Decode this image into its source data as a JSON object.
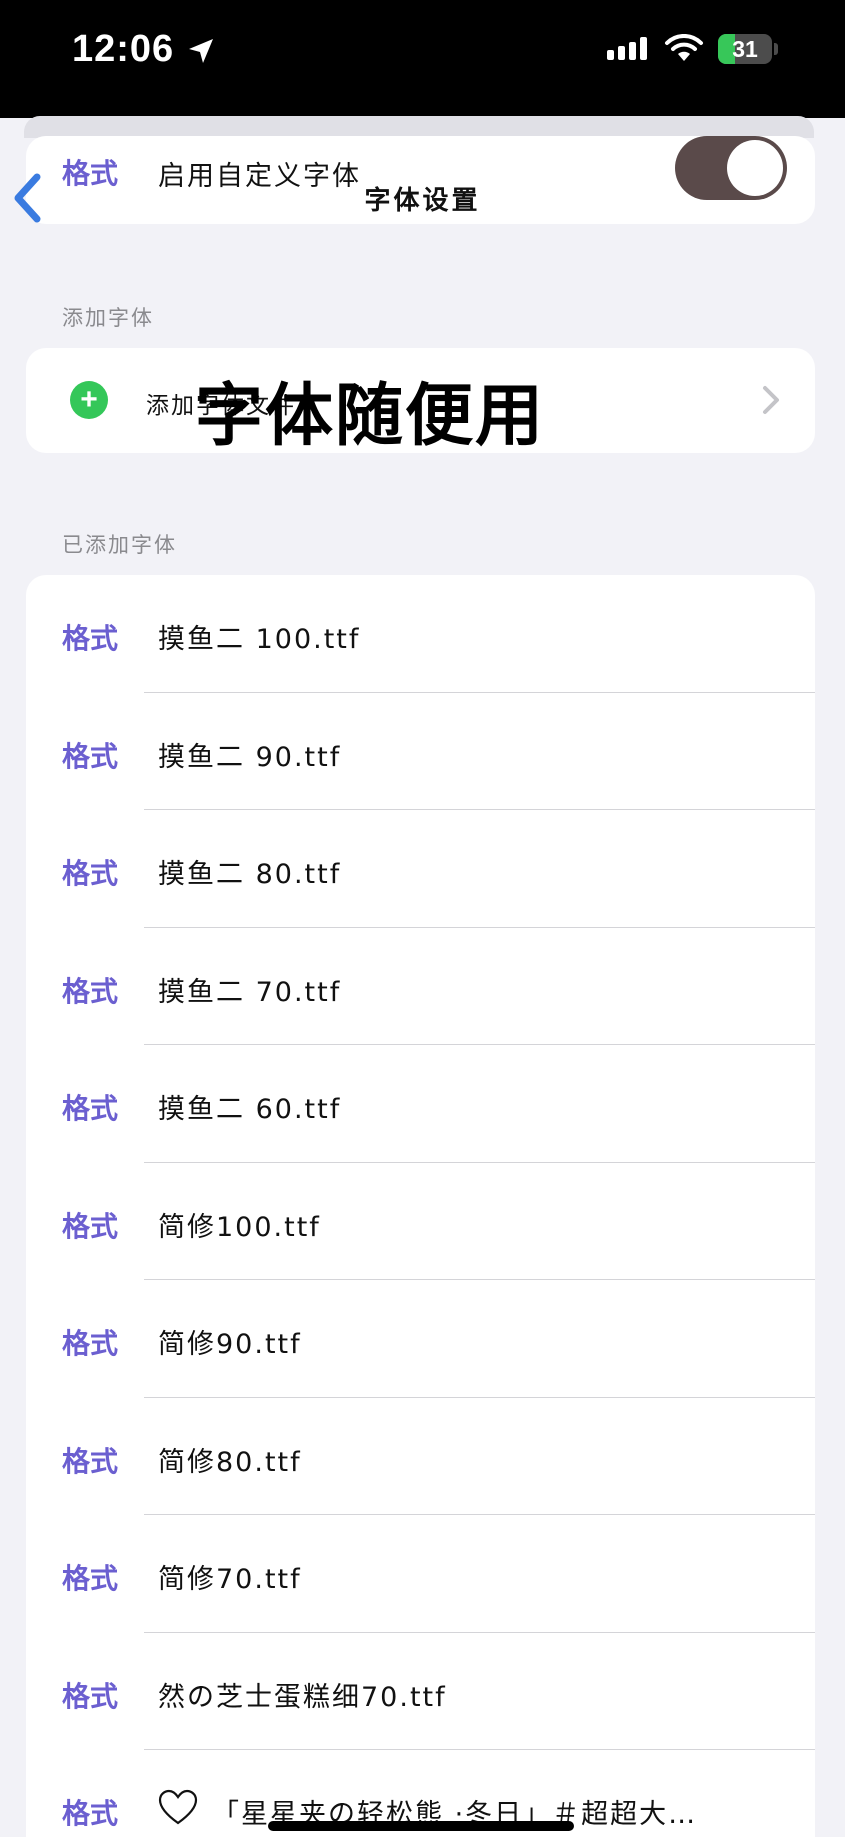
{
  "status_bar": {
    "time": "12:06",
    "battery_level": "31",
    "battery_fraction": 0.31,
    "icons": [
      "location-arrow-icon",
      "cellular-signal-icon",
      "wifi-icon",
      "battery-charging-icon"
    ]
  },
  "nav": {
    "title": "字体设置",
    "back_icon": "chevron-left-icon"
  },
  "custom_font": {
    "tag": "格式",
    "label": "启用自定义字体",
    "enabled": true
  },
  "add_section": {
    "header": "添加字体",
    "row_label": "添加字体文件",
    "overlay": "字体随便用"
  },
  "added_section": {
    "header": "已添加字体",
    "items": [
      {
        "tag": "格式",
        "name": "摸鱼二 100.ttf"
      },
      {
        "tag": "格式",
        "name": "摸鱼二 90.ttf"
      },
      {
        "tag": "格式",
        "name": "摸鱼二 80.ttf"
      },
      {
        "tag": "格式",
        "name": "摸鱼二 70.ttf"
      },
      {
        "tag": "格式",
        "name": "摸鱼二 60.ttf"
      },
      {
        "tag": "格式",
        "name": "简修100.ttf"
      },
      {
        "tag": "格式",
        "name": "简修90.ttf"
      },
      {
        "tag": "格式",
        "name": "简修80.ttf"
      },
      {
        "tag": "格式",
        "name": "简修70.ttf"
      },
      {
        "tag": "格式",
        "name": "然の芝士蛋糕细70.ttf"
      },
      {
        "tag": "格式",
        "name": "「星星夹の轻松熊 ·冬日」＃超超大…"
      }
    ]
  },
  "colors": {
    "accent": "#6b5fd0",
    "green": "#34c759",
    "toggle_on": "#5a4a4a",
    "back_blue": "#3a7be0"
  }
}
